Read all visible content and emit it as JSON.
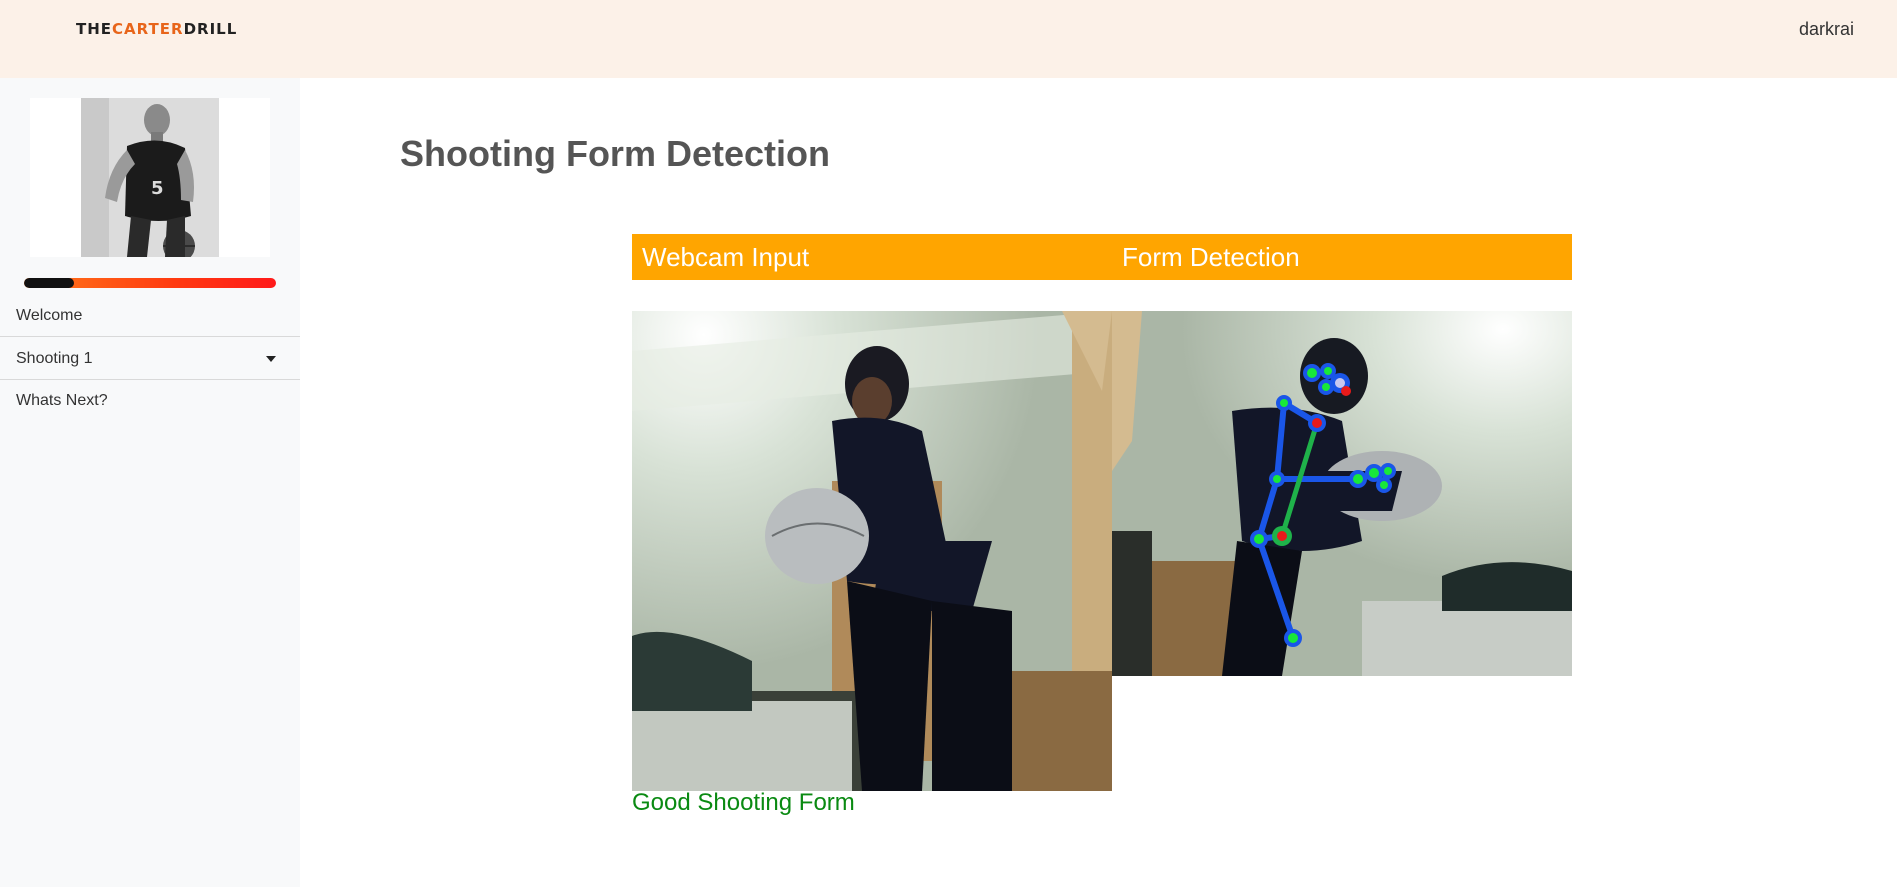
{
  "brand": {
    "part1": "THE",
    "part2": "CARTER",
    "part3": "DRILL"
  },
  "header": {
    "username": "darkrai"
  },
  "sidebar": {
    "progress_percent": 20,
    "items": [
      {
        "label": "Welcome"
      },
      {
        "label": "Shooting 1"
      },
      {
        "label": "Whats Next?"
      }
    ]
  },
  "main": {
    "title": "Shooting Form Detection",
    "panels": {
      "left_label": "Webcam Input",
      "right_label": "Form Detection"
    },
    "status": "Good Shooting Form",
    "colors": {
      "accent": "#ffa500",
      "status": "#0a8a12",
      "brand": "#e8651a"
    }
  }
}
